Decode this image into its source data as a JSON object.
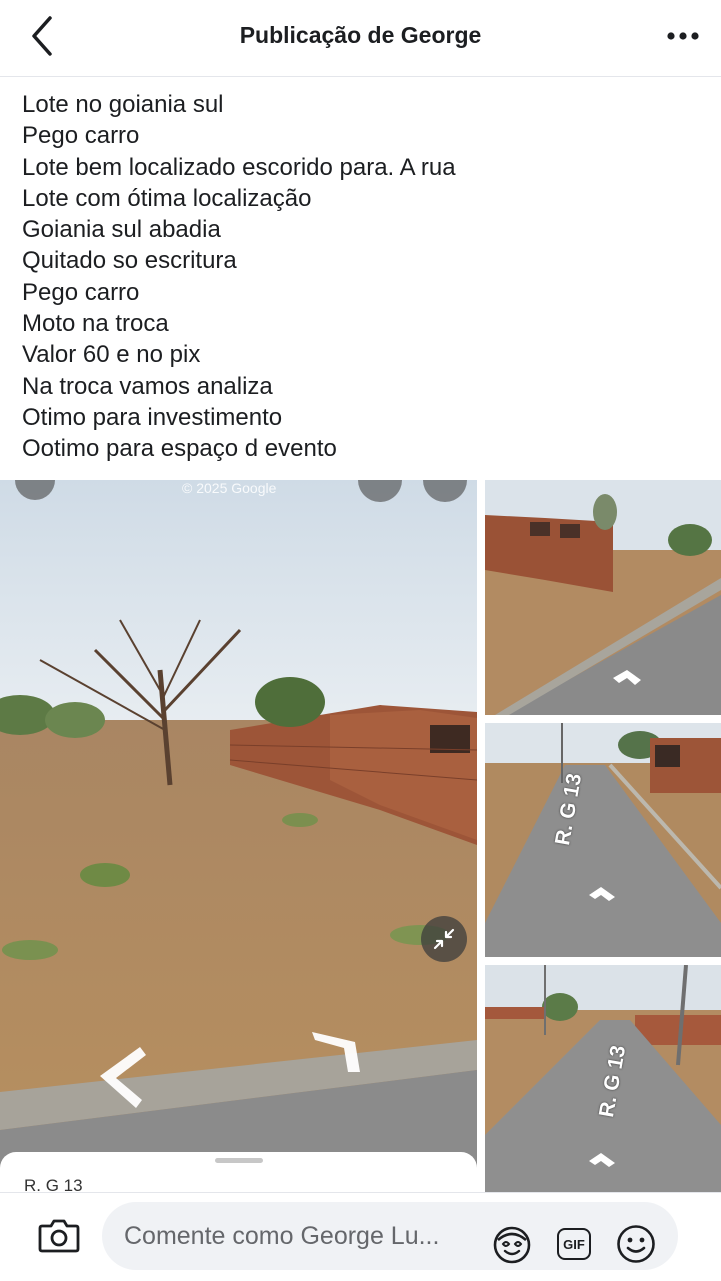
{
  "header": {
    "title": "Publicação de George",
    "back_icon": "chevron-left-icon",
    "more_icon": "more-horizontal-icon"
  },
  "post": {
    "lines": [
      "Lote no goiania sul",
      "Pego carro",
      "Lote bem localizado escorido para. A rua",
      "Lote com ótima localização",
      "Goiania sul abadia",
      "Quitado so escritura",
      "Pego carro",
      "Moto na troca",
      "Valor 60 e no pix",
      "Na troca vamos analiza",
      "Otimo para investimento",
      "Ootimo para espaço d evento"
    ]
  },
  "photos": {
    "main": {
      "watermark": "© 2025 Google",
      "panel_label": "R. G 13"
    },
    "street_label": "R. G 13"
  },
  "footer": {
    "comment_placeholder": "Comente como George Lu...",
    "gif_label": "GIF",
    "camera_icon": "camera-icon",
    "avatar_sticker_icon": "avatar-sticker-icon",
    "gif_icon": "gif-icon",
    "emoji_icon": "emoji-icon"
  },
  "colors": {
    "sky": "#dde6ee",
    "dirt": "#b58a5a",
    "brick": "#a4583c",
    "road": "#8d8d8d"
  }
}
